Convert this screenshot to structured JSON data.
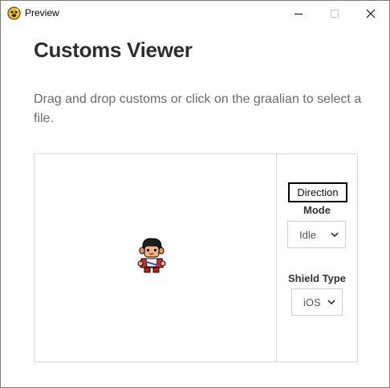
{
  "window": {
    "title": "Preview",
    "app_icon": "paw-icon",
    "controls": [
      "minimize-icon",
      "maximize-icon",
      "close-icon"
    ]
  },
  "page": {
    "title": "Customs Viewer",
    "description": "Drag and drop customs or click on the graalian to select a file."
  },
  "viewer": {
    "sprite": "graalian-character",
    "direction_button": "Direction",
    "mode_label": "Mode",
    "mode_value": "Idle",
    "shield_label": "Shield Type",
    "shield_value": "iOS"
  },
  "colors": {
    "heading": "#2e2e2e",
    "description": "#6b6b6b",
    "border": "#d7d7d7"
  }
}
